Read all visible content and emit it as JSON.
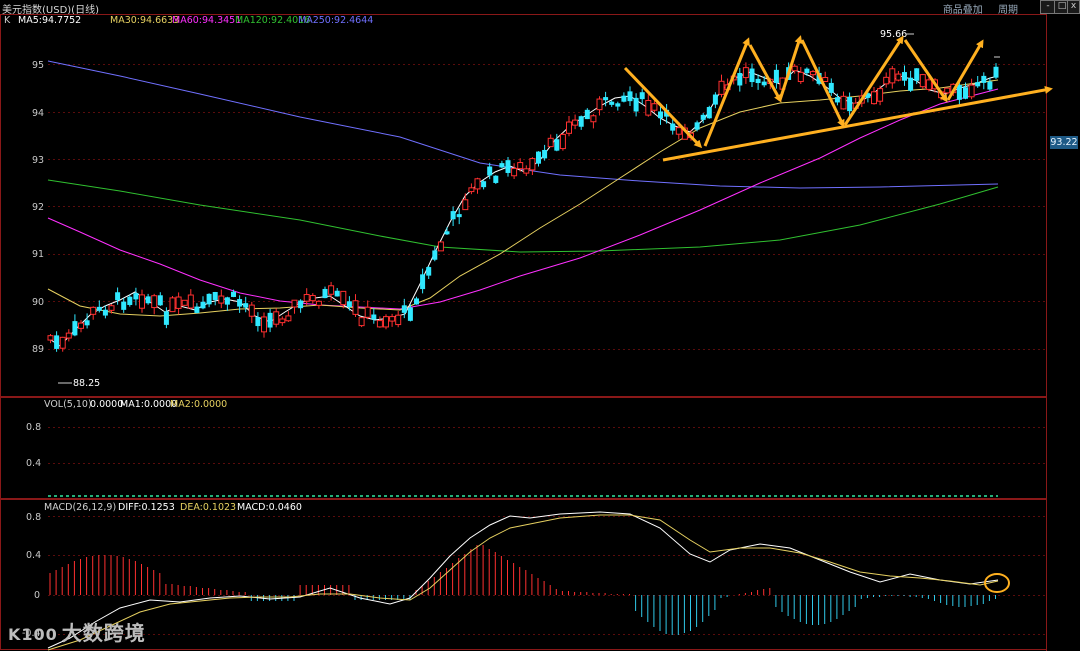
{
  "window": {
    "title": "美元指数(USD)(日线)",
    "tools": [
      "商品叠加",
      "周期"
    ],
    "buttons": {
      "minimize": "-",
      "maximize": "□",
      "close": "x"
    }
  },
  "price_panel": {
    "legend": [
      {
        "text": "K",
        "color": "#d0d0d0"
      },
      {
        "text": "MA5:94.7752",
        "color": "#ffffff"
      },
      {
        "text": "MA30:94.6633",
        "color": "#e6d060"
      },
      {
        "text": "MA60:94.3451",
        "color": "#ff30ff"
      },
      {
        "text": "MA120:92.4016",
        "color": "#30c030"
      },
      {
        "text": "MA250:92.4644",
        "color": "#7070ff"
      }
    ],
    "yticks": [
      "95",
      "94",
      "93",
      "92",
      "91",
      "90",
      "89"
    ],
    "low_label": "88.25",
    "high_label": "95.66",
    "price_tag": "93.22"
  },
  "volume_panel": {
    "legend": [
      {
        "text": "VOL(5,10)",
        "color": "#d0d0d0"
      },
      {
        "text": "0.0000",
        "color": "#ffffff"
      },
      {
        "text": "MA1:0.0000",
        "color": "#ffffff"
      },
      {
        "text": "MA2:0.0000",
        "color": "#e6d060"
      }
    ],
    "yticks": [
      "0.8",
      "0.4"
    ]
  },
  "macd_panel": {
    "legend": [
      {
        "text": "MACD(26,12,9)",
        "color": "#d0d0d0"
      },
      {
        "text": "DIFF:0.1253",
        "color": "#ffffff"
      },
      {
        "text": "DEA:0.1023",
        "color": "#e6d060"
      },
      {
        "text": "MACD:0.0460",
        "color": "#ffffff"
      }
    ],
    "yticks": [
      "0.8",
      "0.4",
      "0",
      "-0.4"
    ]
  },
  "watermark": {
    "logo": "K100",
    "text": "大数跨境"
  },
  "colors": {
    "up": "#ff3030",
    "down": "#30e8ff",
    "grid": "#7a1010",
    "annotation": "#ffb020"
  }
}
